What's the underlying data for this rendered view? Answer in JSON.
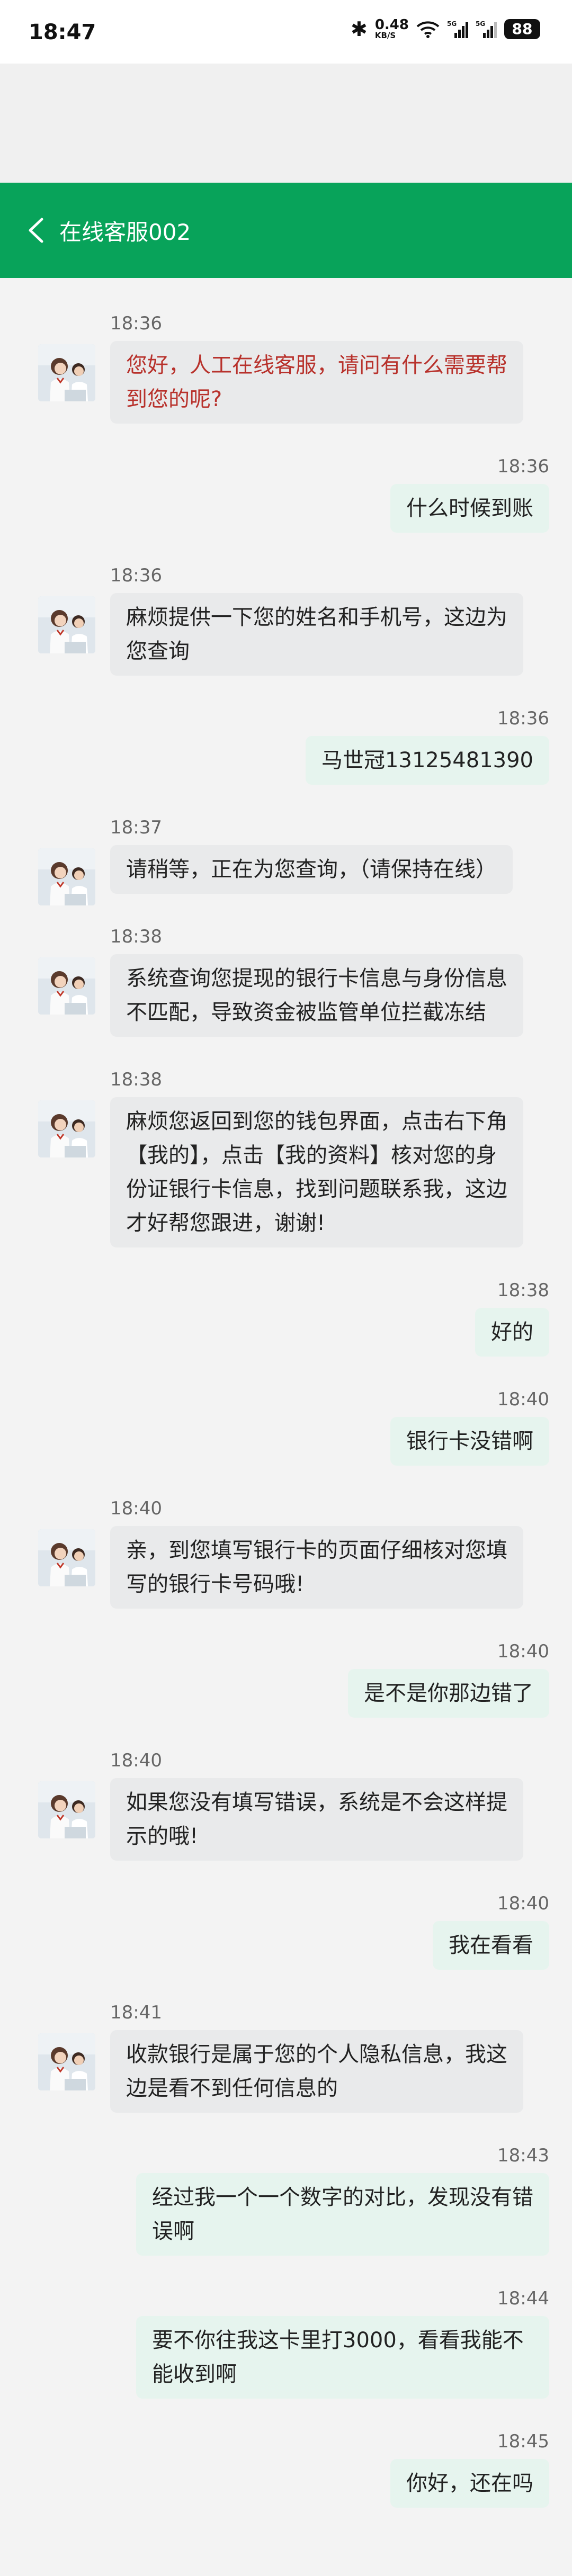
{
  "status_bar": {
    "time": "18:47",
    "net_speed": "0.48",
    "net_unit": "KB/S",
    "signal_1": "5G",
    "signal_2": "5G",
    "battery": "88"
  },
  "header": {
    "title": "在线客服002",
    "bg_color": "#08a35a"
  },
  "messages": [
    {
      "side": "left",
      "time": "18:36",
      "text": "您好，人工在线客服，请问有什么需要帮到您的呢?",
      "style": "red"
    },
    {
      "side": "right",
      "time": "18:36",
      "text": "什么时候到账"
    },
    {
      "side": "left",
      "time": "18:36",
      "text": "麻烦提供一下您的姓名和手机号，这边为您查询"
    },
    {
      "side": "right",
      "time": "18:36",
      "text": "马世冠13125481390"
    },
    {
      "side": "left",
      "time": "18:37",
      "text": "请稍等，正在为您查询，（请保持在线）"
    },
    {
      "side": "left",
      "time": "18:38",
      "text": "系统查询您提现的银行卡信息与身份信息不匹配，导致资金被监管单位拦截冻结"
    },
    {
      "side": "left",
      "time": "18:38",
      "text": "麻烦您返回到您的钱包界面，点击右下角【我的】，点击【我的资料】核对您的身份证银行卡信息，找到问题联系我，这边才好帮您跟进，谢谢!"
    },
    {
      "side": "right",
      "time": "18:38",
      "text": "好的"
    },
    {
      "side": "right",
      "time": "18:40",
      "text": "银行卡没错啊"
    },
    {
      "side": "left",
      "time": "18:40",
      "text": "亲，到您填写银行卡的页面仔细核对您填写的银行卡号码哦!"
    },
    {
      "side": "right",
      "time": "18:40",
      "text": "是不是你那边错了"
    },
    {
      "side": "left",
      "time": "18:40",
      "text": "如果您没有填写错误，系统是不会这样提示的哦!"
    },
    {
      "side": "right",
      "time": "18:40",
      "text": "我在看看"
    },
    {
      "side": "left",
      "time": "18:41",
      "text": "收款银行是属于您的个人隐私信息，我这边是看不到任何信息的"
    },
    {
      "side": "right",
      "time": "18:43",
      "text": "经过我一个一个数字的对比，发现没有错误啊"
    },
    {
      "side": "right",
      "time": "18:44",
      "text": "要不你往我这卡里打3000，看看我能不能收到啊"
    },
    {
      "side": "right",
      "time": "18:45",
      "text": "你好，还在吗"
    }
  ]
}
